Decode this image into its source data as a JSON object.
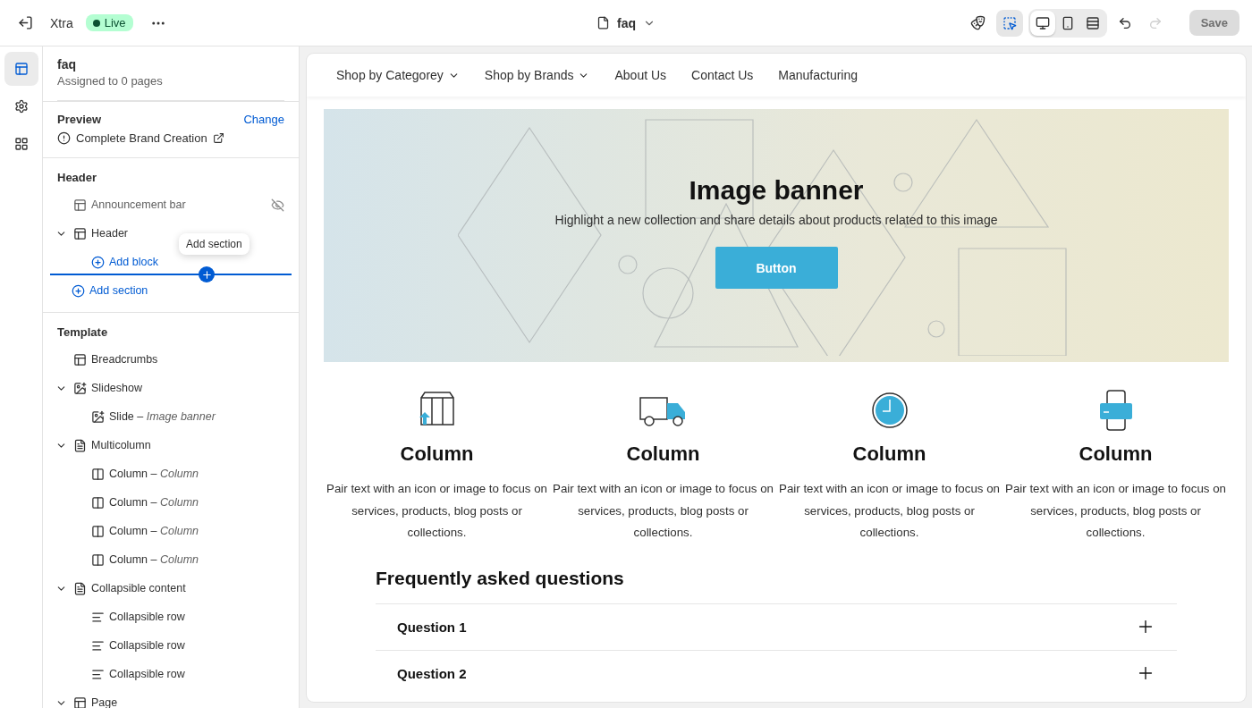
{
  "topbar": {
    "store": "Xtra",
    "status": "Live",
    "page": "faq",
    "tools": [
      {
        "kind": "inspect",
        "selected": true
      },
      {
        "kind": "desktop",
        "selected": true
      },
      {
        "kind": "mobile",
        "selected": false
      },
      {
        "kind": "fullwidth",
        "selected": false
      }
    ],
    "redo_disabled": true,
    "save": {
      "label": "Save",
      "disabled": true
    }
  },
  "rail": [
    {
      "kind": "sections",
      "selected": true
    },
    {
      "kind": "settings",
      "selected": false
    },
    {
      "kind": "apps",
      "selected": false
    }
  ],
  "sidebar": {
    "title": "faq",
    "subtitle": "Assigned to 0 pages",
    "preview": {
      "label": "Preview",
      "action": "Change",
      "value": "Complete Brand Creation"
    },
    "header_group": {
      "title": "Header",
      "items": [
        {
          "label": "Announcement bar",
          "kind": "section",
          "hidden": true
        },
        {
          "label": "Header",
          "kind": "section",
          "hidden": false,
          "expanded": true,
          "children": [
            {
              "label": "Add block",
              "kind": "add"
            }
          ]
        }
      ],
      "add_section": "Add section",
      "tooltip": "Add section"
    },
    "template_group": {
      "title": "Template",
      "items": [
        {
          "label": "Breadcrumbs",
          "kind": "section"
        },
        {
          "label": "Slideshow",
          "kind": "image",
          "expanded": true,
          "children": [
            {
              "label": "Slide – *Image banner*",
              "kind": "image"
            }
          ]
        },
        {
          "label": "Multicolumn",
          "kind": "text",
          "expanded": true,
          "children": [
            {
              "label": "Column – *Column*",
              "kind": "column"
            },
            {
              "label": "Column – *Column*",
              "kind": "column"
            },
            {
              "label": "Column – *Column*",
              "kind": "column"
            },
            {
              "label": "Column – *Column*",
              "kind": "column"
            }
          ]
        },
        {
          "label": "Collapsible content",
          "kind": "text",
          "expanded": true,
          "children": [
            {
              "label": "Collapsible row",
              "kind": "rows"
            },
            {
              "label": "Collapsible row",
              "kind": "rows"
            },
            {
              "label": "Collapsible row",
              "kind": "rows"
            }
          ]
        },
        {
          "label": "Page",
          "kind": "section",
          "expanded": true
        }
      ]
    }
  },
  "preview": {
    "nav": [
      {
        "label": "Shop by Categorey",
        "dropdown": true
      },
      {
        "label": "Shop by Brands",
        "dropdown": true
      },
      {
        "label": "About Us",
        "dropdown": false
      },
      {
        "label": "Contact Us",
        "dropdown": false
      },
      {
        "label": "Manufacturing",
        "dropdown": false
      }
    ],
    "banner": {
      "title": "Image banner",
      "text": "Highlight a new collection and share details about products related to this image",
      "button": "Button"
    },
    "columns": [
      {
        "kind": "box",
        "title": "Column",
        "text": "Pair text with an icon or image to focus on services, products, blog posts or collections."
      },
      {
        "kind": "truck",
        "title": "Column",
        "text": "Pair text with an icon or image to focus on services, products, blog posts or collections."
      },
      {
        "kind": "clock",
        "title": "Column",
        "text": "Pair text with an icon or image to focus on services, products, blog posts or collections."
      },
      {
        "kind": "phone",
        "title": "Column",
        "text": "Pair text with an icon or image to focus on services, products, blog posts or collections."
      }
    ],
    "faq": {
      "title": "Frequently asked questions",
      "questions": [
        {
          "label": "Question 1",
          "expanded": false
        },
        {
          "label": "Question 2",
          "expanded": false
        }
      ]
    }
  }
}
